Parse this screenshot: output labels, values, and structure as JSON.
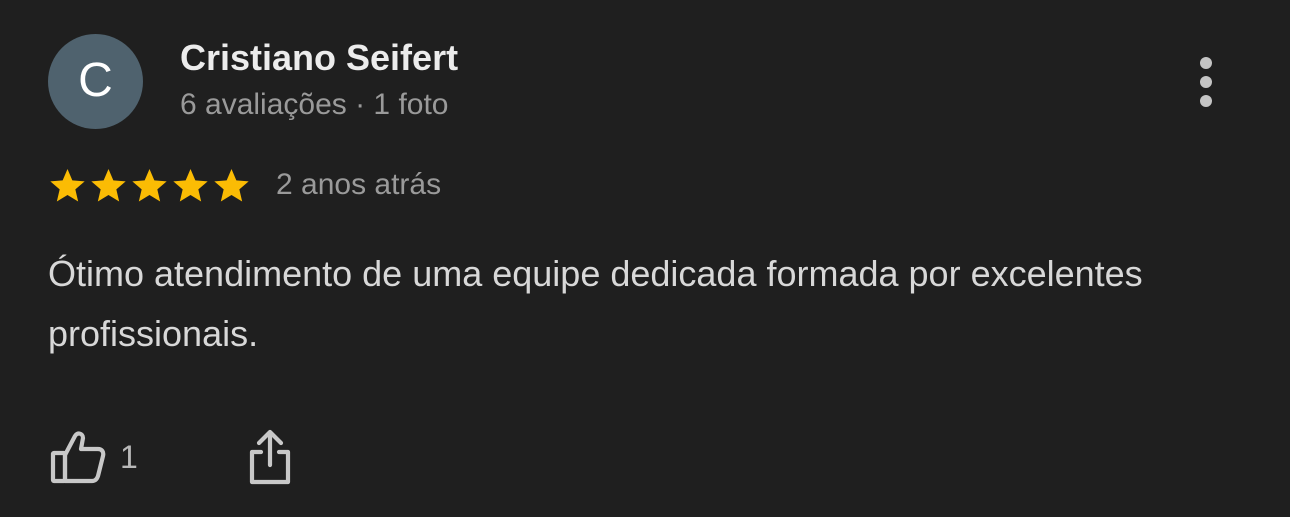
{
  "review": {
    "author": {
      "initial": "C",
      "name": "Cristiano Seifert",
      "meta": "6 avaliações · 1 foto",
      "avatar_color": "#4f626e"
    },
    "rating": 5,
    "max_rating": 5,
    "star_color": "#fbbc04",
    "date": "2 anos atrás",
    "text": "Ótimo atendimento de uma equipe dedicada formada por excelentes profissionais.",
    "actions": {
      "like_icon": "thumb-up-icon",
      "like_count": "1",
      "share_icon": "share-icon",
      "more_icon": "more-vertical-icon"
    }
  }
}
